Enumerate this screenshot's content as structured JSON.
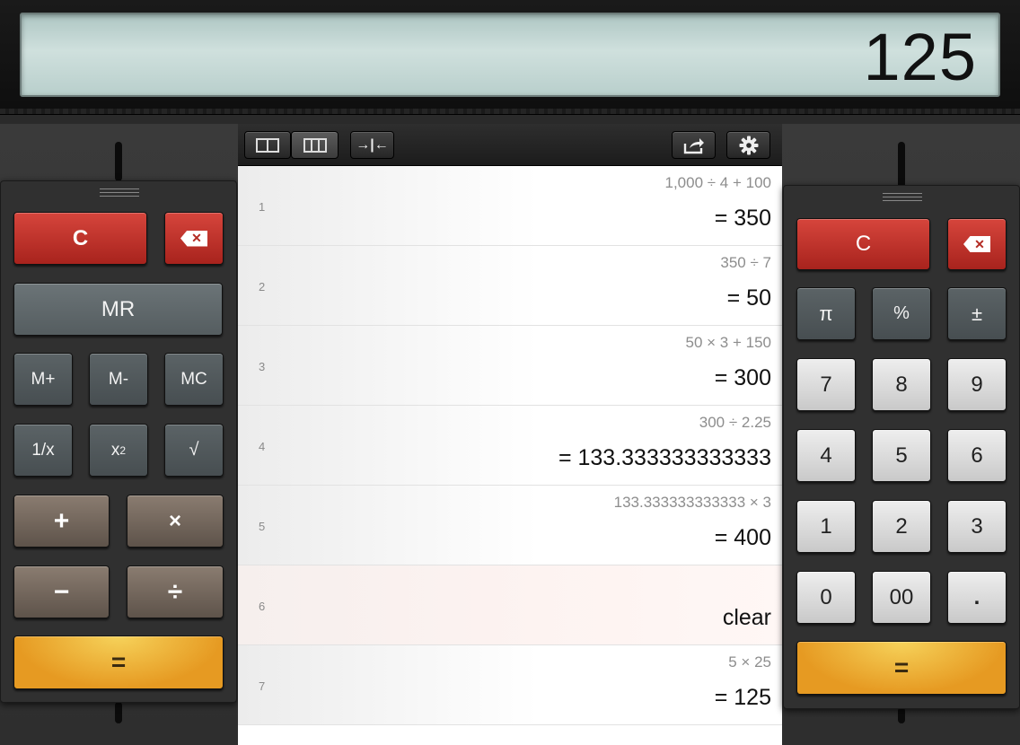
{
  "display": {
    "value": "125"
  },
  "toolbar": {
    "share_icon": "share-icon",
    "settings_icon": "gear-icon",
    "collapse_icon": "collapse-arrows-icon"
  },
  "tape": {
    "rows": [
      {
        "num": "1",
        "expr": "1,000 ÷ 4 + 100",
        "result": "= 350"
      },
      {
        "num": "2",
        "expr": "350 ÷ 7",
        "result": "= 50"
      },
      {
        "num": "3",
        "expr": "50 × 3 + 150",
        "result": "= 300"
      },
      {
        "num": "4",
        "expr": "300 ÷ 2.25",
        "result": "= 133.333333333333"
      },
      {
        "num": "5",
        "expr": "133.333333333333 × 3",
        "result": "= 400"
      },
      {
        "num": "6",
        "expr": "",
        "result": "clear"
      },
      {
        "num": "7",
        "expr": "5 × 25",
        "result": "= 125"
      }
    ]
  },
  "left_keys": {
    "clear": "C",
    "mr": "MR",
    "mplus": "M+",
    "mminus": "M-",
    "mc": "MC",
    "recip": "1/x",
    "square_base": "x",
    "square_exp": "2",
    "sqrt": "√",
    "plus": "+",
    "times": "×",
    "minus": "−",
    "divide": "÷",
    "equals": "="
  },
  "right_keys": {
    "clear": "C",
    "pi": "π",
    "percent": "%",
    "plusminus": "±",
    "k7": "7",
    "k8": "8",
    "k9": "9",
    "k4": "4",
    "k5": "5",
    "k6": "6",
    "k1": "1",
    "k2": "2",
    "k3": "3",
    "k0": "0",
    "k00": "00",
    "dot": ".",
    "equals": "="
  }
}
